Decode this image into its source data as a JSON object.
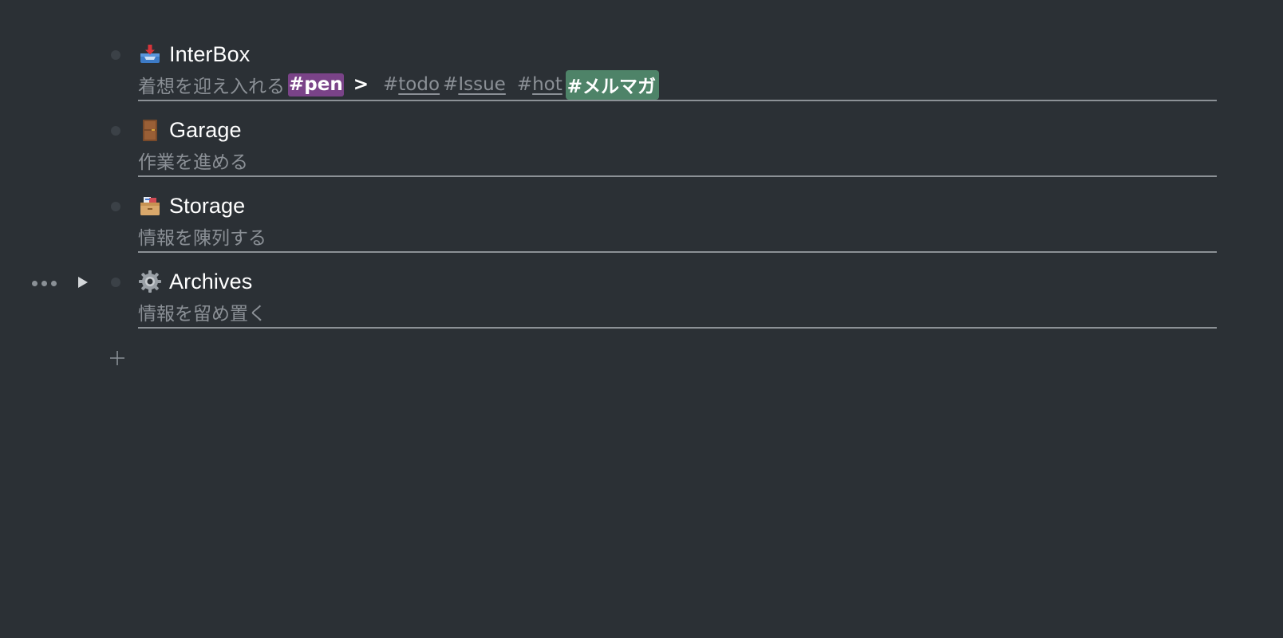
{
  "outline": {
    "items": [
      {
        "icon": "inbox-tray-icon",
        "title": "InterBox",
        "note_text": "着想を迎え入れる",
        "tags": {
          "pen": "#pen",
          "arrow": ">",
          "todo_hash": "#",
          "todo": "todo",
          "issue_hash": "#",
          "issue": "Issue",
          "hot_hash": "#",
          "hot": "hot",
          "mailmag": "#メルマガ"
        },
        "tag_colors": {
          "pen": "#7a4388",
          "mailmag": "#4e8368"
        }
      },
      {
        "icon": "door-icon",
        "title": "Garage",
        "note_text": "作業を進める"
      },
      {
        "icon": "card-file-box-icon",
        "title": "Storage",
        "note_text": "情報を陳列する"
      },
      {
        "icon": "gear-icon",
        "title": "Archives",
        "note_text": "情報を留め置く",
        "hovered": true
      }
    ],
    "add_button_icon": "plus-icon"
  },
  "colors": {
    "background": "#2b3035",
    "title": "#ffffff",
    "note": "#8b9096",
    "bullet": "#3b4147"
  }
}
